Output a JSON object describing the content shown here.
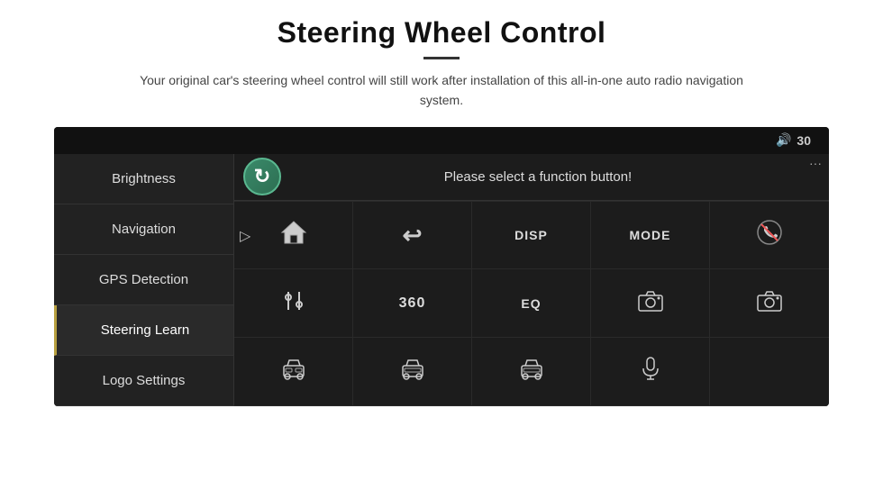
{
  "header": {
    "title": "Steering Wheel Control",
    "subtitle": "Your original car's steering wheel control will still work after installation of this all-in-one auto radio navigation system."
  },
  "topbar": {
    "volume_icon": "🔊",
    "volume_value": "30"
  },
  "sidebar": {
    "items": [
      {
        "label": "Brightness",
        "active": false
      },
      {
        "label": "Navigation",
        "active": false
      },
      {
        "label": "GPS Detection",
        "active": false
      },
      {
        "label": "Steering Learn",
        "active": true
      },
      {
        "label": "Logo Settings",
        "active": false
      }
    ]
  },
  "right_panel": {
    "header_message": "Please select a function button!",
    "refresh_icon": "↻",
    "buttons": [
      {
        "type": "icon",
        "icon": "🏠",
        "label": "home"
      },
      {
        "type": "icon",
        "icon": "↩",
        "label": "back"
      },
      {
        "type": "text",
        "text": "DISP",
        "label": "disp"
      },
      {
        "type": "text",
        "text": "MODE",
        "label": "mode"
      },
      {
        "type": "icon",
        "icon": "🚫📞",
        "label": "mute-call"
      },
      {
        "type": "icon",
        "icon": "🎛",
        "label": "settings"
      },
      {
        "type": "text",
        "text": "360",
        "label": "360"
      },
      {
        "type": "text",
        "text": "EQ",
        "label": "eq"
      },
      {
        "type": "icon",
        "icon": "📷",
        "label": "camera"
      },
      {
        "type": "icon",
        "icon": "📷",
        "label": "camera2"
      },
      {
        "type": "icon",
        "icon": "🚗",
        "label": "car1"
      },
      {
        "type": "icon",
        "icon": "🚗",
        "label": "car2"
      },
      {
        "type": "icon",
        "icon": "🚗",
        "label": "car3"
      },
      {
        "type": "icon",
        "icon": "🎤",
        "label": "mic"
      },
      {
        "type": "empty",
        "label": "empty"
      }
    ]
  }
}
